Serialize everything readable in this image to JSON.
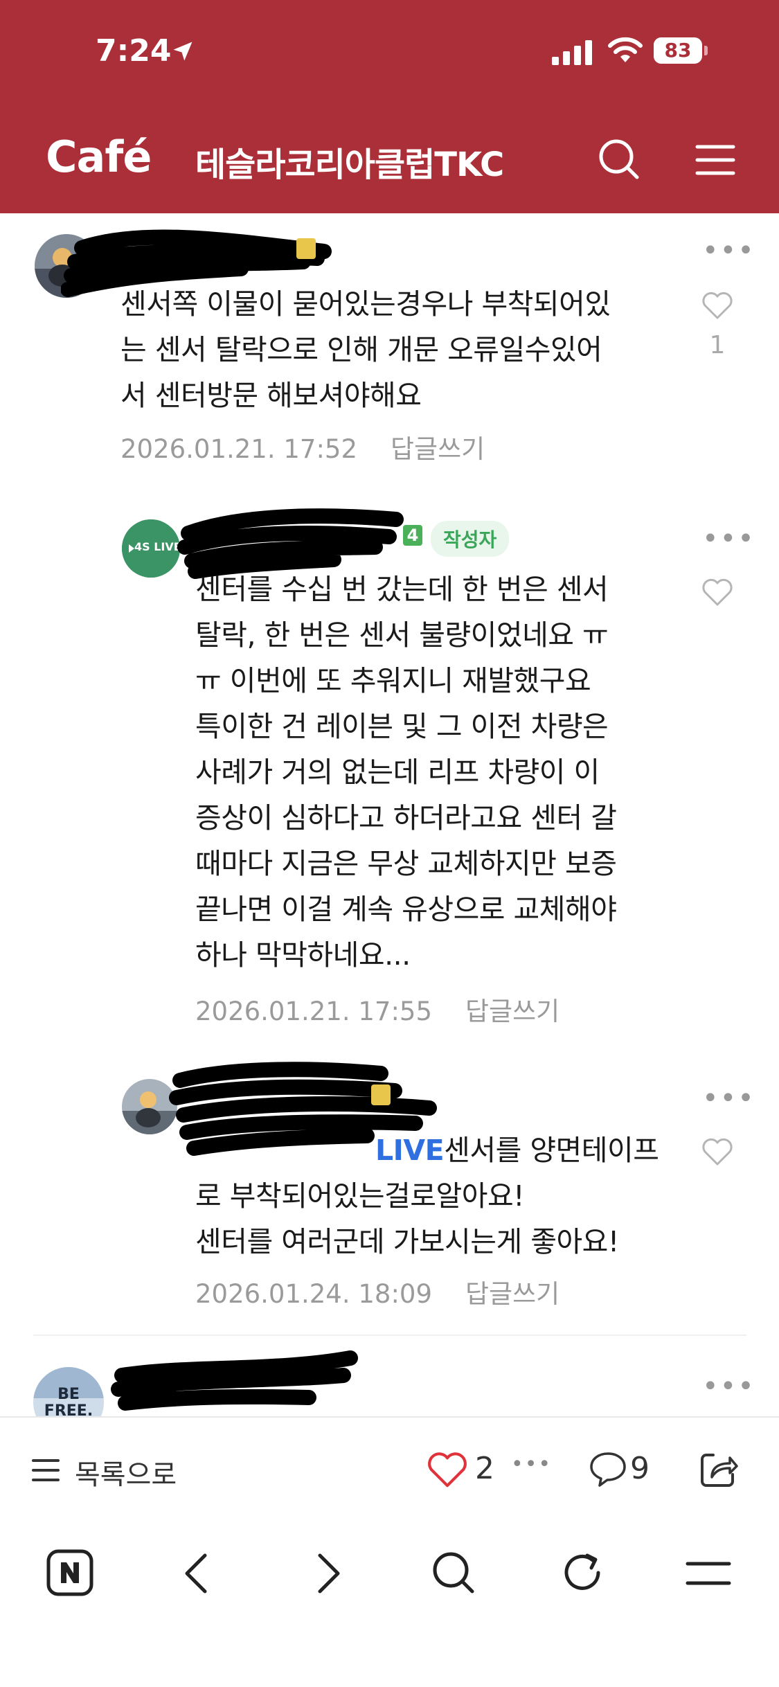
{
  "status_bar": {
    "time": "7:24",
    "battery": "83",
    "battery_level": 0.83
  },
  "header": {
    "logo": "Café",
    "cafe_name": "테슬라코리아클럽TKC"
  },
  "comments": [
    {
      "lines": [
        "센서쪽 이물이 묻어있는경우나 부착되어있",
        "는 센서 탈락으로 인해 개문 오류일수있어",
        "서 센터방문 해보셔야해요"
      ],
      "date": "2026.01.21. 17:52",
      "reply": "답글쓰기",
      "likes": "1"
    },
    {
      "author_badge": "작성자",
      "level": "4",
      "avatar_text": "4S LIVE",
      "lines": [
        "센터를 수십 번 갔는데 한 번은 센서",
        "탈락, 한 번은 센서 불량이었네요 ㅠ",
        "ㅠ 이번에 또 추워지니 재발했구요",
        "특이한 건 레이븐 및 그 이전 차량은",
        "사례가 거의 없는데 리프 차량이 이",
        "증상이 심하다고 하더라고요 센터 갈",
        "때마다 지금은 무상 교체하지만 보증",
        "끝나면 이걸 계속 유상으로 교체해야",
        "하나 막막하네요..."
      ],
      "date": "2026.01.21. 17:55",
      "reply": "답글쓰기"
    },
    {
      "mention": "LIVE",
      "first_line": "센서를 양면테이프",
      "lines": [
        "로 부착되어있는걸로알아요!",
        "센터를 여러군데 가보시는게 좋아요!"
      ],
      "date": "2026.01.24. 18:09",
      "reply": "답글쓰기"
    },
    {
      "avatar_text": "BE FREE."
    }
  ],
  "action_bar": {
    "list_label": "목록으로",
    "likes": "2",
    "comments": "9"
  },
  "colors": {
    "brand": "#ab2f38",
    "meta": "#9a9a9a",
    "heart": "#e0323a",
    "author_badge": "#3aa657"
  }
}
